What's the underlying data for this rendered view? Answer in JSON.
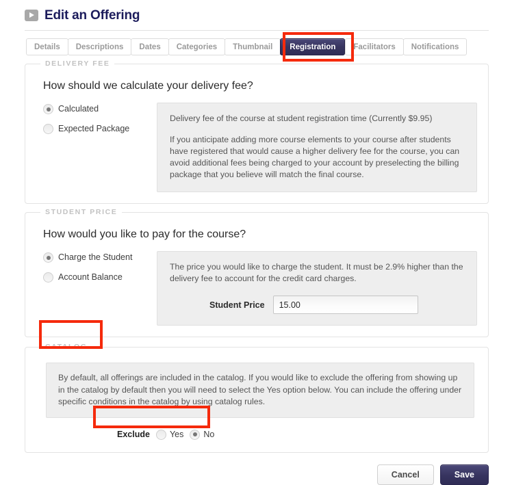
{
  "header": {
    "title": "Edit an Offering",
    "toggle_icon": "play-triangle-icon"
  },
  "tabs": [
    {
      "label": "Details",
      "selected": false
    },
    {
      "label": "Descriptions",
      "selected": false
    },
    {
      "label": "Dates",
      "selected": false
    },
    {
      "label": "Categories",
      "selected": false
    },
    {
      "label": "Thumbnail",
      "selected": false
    },
    {
      "label": "Registration",
      "selected": true
    },
    {
      "label": "Facilitators",
      "selected": false
    },
    {
      "label": "Notifications",
      "selected": false
    }
  ],
  "delivery_fee": {
    "legend": "DELIVERY FEE",
    "question": "How should we calculate your delivery fee?",
    "options": [
      {
        "label": "Calculated",
        "checked": true
      },
      {
        "label": "Expected Package",
        "checked": false
      }
    ],
    "info_paragraph_1": "Delivery fee of the course at student registration time (Currently $9.95)",
    "info_paragraph_2": "If you anticipate adding more course elements to your course after students have registered that would cause a higher delivery fee for the course, you can avoid additional fees being charged to your account by preselecting the billing package that you believe will match the final course."
  },
  "student_price": {
    "legend": "STUDENT PRICE",
    "question": "How would you like to pay for the course?",
    "options": [
      {
        "label": "Charge the Student",
        "checked": true
      },
      {
        "label": "Account Balance",
        "checked": false
      }
    ],
    "info_paragraph": "The price you would like to charge the student. It must be 2.9% higher than the delivery fee to account for the credit card charges.",
    "field_label": "Student Price",
    "field_value": "15.00"
  },
  "catalog": {
    "legend": "CATALOG",
    "info_paragraph": "By default, all offerings are included in the catalog. If you would like to exclude the offering from showing up in the catalog by default then you will need to select the Yes option below. You can include the offering under specific conditions in the catalog by using catalog rules.",
    "exclude_label": "Exclude",
    "options": [
      {
        "label": "Yes",
        "checked": false
      },
      {
        "label": "No",
        "checked": true
      }
    ]
  },
  "footer": {
    "cancel_label": "Cancel",
    "save_label": "Save"
  },
  "colors": {
    "accent_navy": "#37345f",
    "title_navy": "#1c1c5c",
    "annotation_red": "#f52a0c",
    "panel_gray": "#eeeeee",
    "legend_gray": "#c2c2c2"
  }
}
